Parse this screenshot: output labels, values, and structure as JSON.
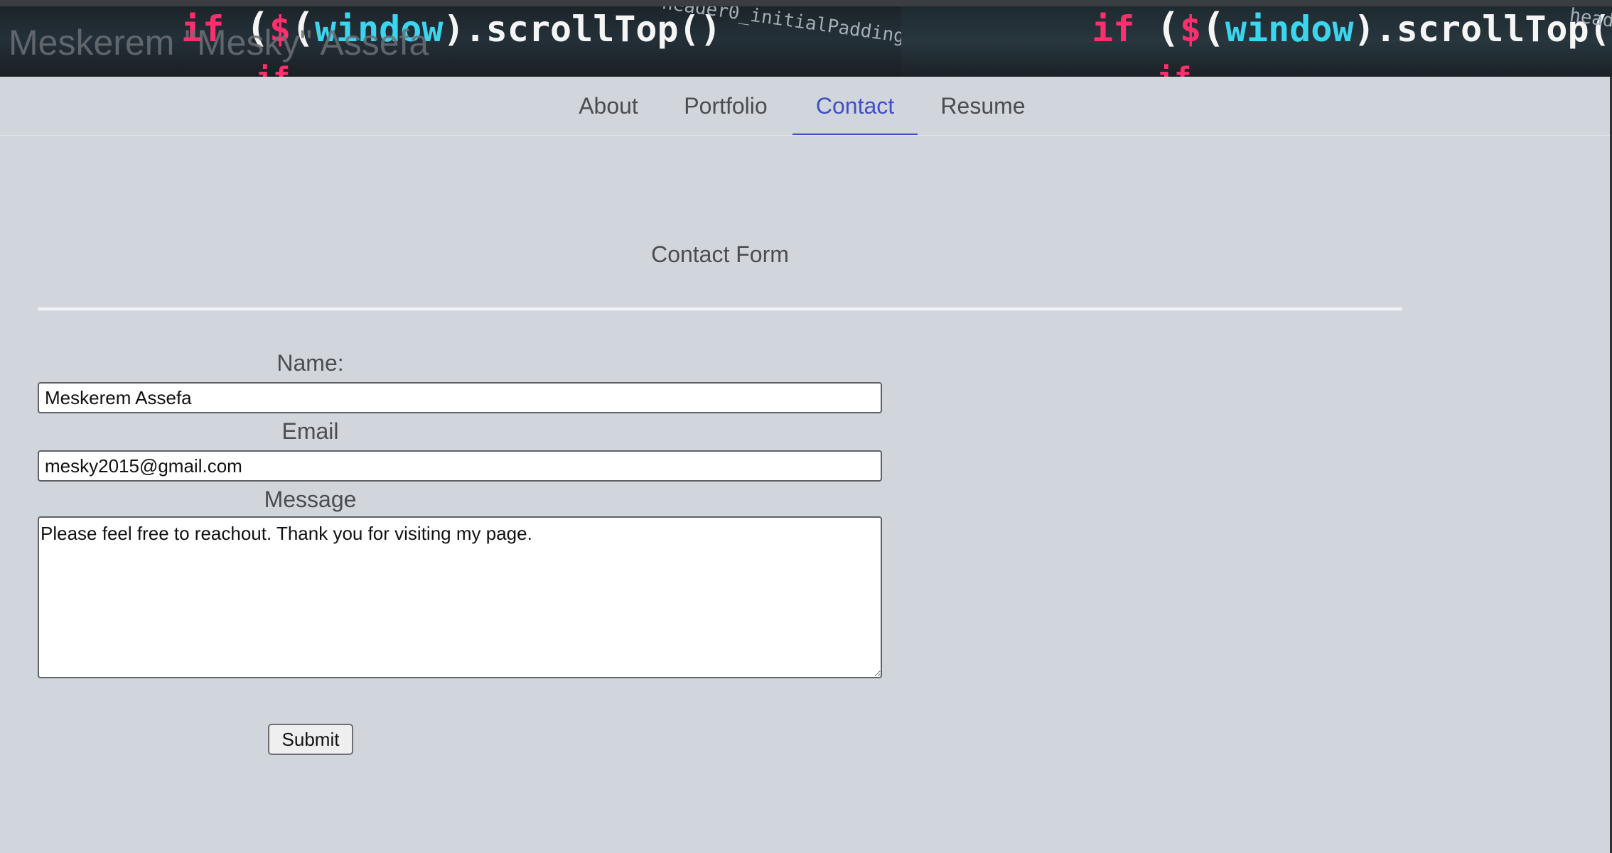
{
  "site": {
    "title": "Meskerem \"Mesky\" Assefa"
  },
  "header_code": {
    "line1_kw": "if",
    "line1_a": "($(",
    "line1_fn": "window",
    "line1_b": ").scrollTop()",
    "faded_text": "header0_initialPadding"
  },
  "nav": {
    "items": [
      {
        "label": "About",
        "active": false
      },
      {
        "label": "Portfolio",
        "active": false
      },
      {
        "label": "Contact",
        "active": true
      },
      {
        "label": "Resume",
        "active": false
      }
    ]
  },
  "contact_form": {
    "title": "Contact Form",
    "name_label": "Name:",
    "name_value": "Meskerem Assefa",
    "email_label": "Email",
    "email_value": "mesky2015@gmail.com",
    "message_label": "Message",
    "message_value": "Please feel free to reachout. Thank you for visiting my page.",
    "submit_label": "Submit"
  },
  "colors": {
    "background": "#d1d5dc",
    "accent": "#3f51c5",
    "text": "#4b4d50"
  }
}
